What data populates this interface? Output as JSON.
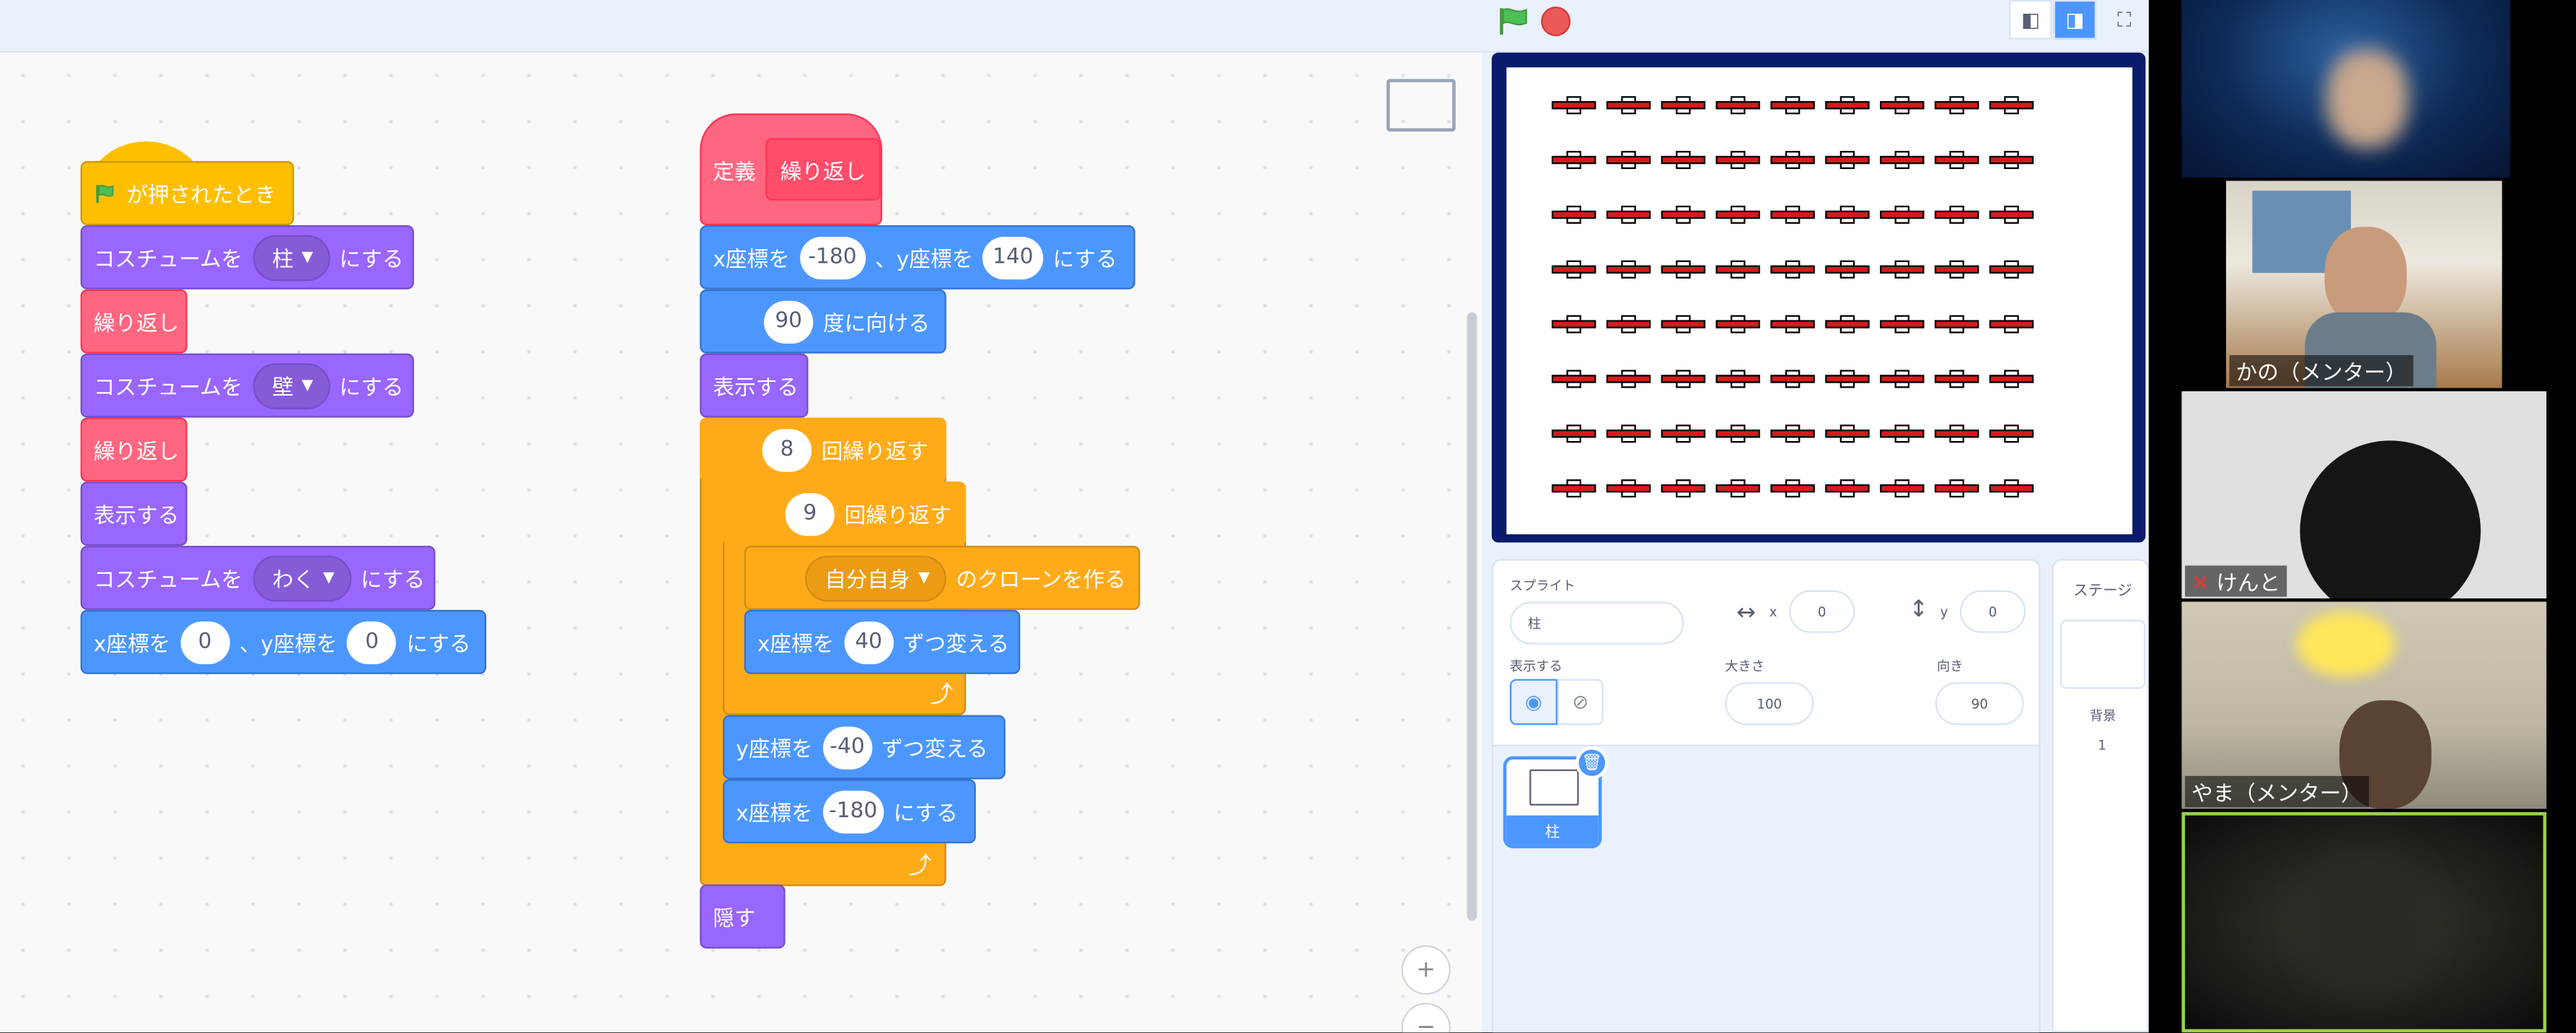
{
  "colors": {
    "motion": "#4c97ff",
    "looks": "#9966ff",
    "control": "#ffab19",
    "events": "#ffbf00",
    "custom": "#ff6680",
    "stage_border": "#0b1b6b",
    "wall_red": "#d41b1b"
  },
  "script1": {
    "hat_label": "が押されたとき",
    "b1": {
      "pre": "コスチュームを",
      "dd": "柱",
      "post": "にする"
    },
    "b2": "繰り返し",
    "b3": {
      "pre": "コスチュームを",
      "dd": "壁",
      "post": "にする"
    },
    "b4": "繰り返し",
    "b5": "表示する",
    "b6": {
      "pre": "コスチュームを",
      "dd": "わく",
      "post": "にする"
    },
    "b7": {
      "x_label": "x座標を",
      "x": "0",
      "y_label": "、y座標を",
      "y": "0",
      "post": "にする"
    }
  },
  "script2": {
    "define_label": "定義",
    "define_name": "繰り返し",
    "goto": {
      "x_label": "x座標を",
      "x": "-180",
      "y_label": "、y座標を",
      "y": "140",
      "post": "にする"
    },
    "point": {
      "val": "90",
      "label": "度に向ける"
    },
    "show": "表示する",
    "repeat_outer": {
      "val": "8",
      "label": "回繰り返す"
    },
    "repeat_inner": {
      "val": "9",
      "label": "回繰り返す"
    },
    "clone": {
      "dd": "自分自身",
      "label": "のクローンを作る"
    },
    "change_x": {
      "label": "x座標を",
      "val": "40",
      "post": "ずつ変える"
    },
    "change_y": {
      "label": "y座標を",
      "val": "-40",
      "post": "ずつ変える"
    },
    "set_x": {
      "label": "x座標を",
      "val": "-180",
      "post": "にする"
    },
    "hide": "隠す"
  },
  "stage": {
    "rows": 8,
    "cols": 9
  },
  "sprite_info": {
    "sprite_label": "スプライト",
    "sprite_name": "柱",
    "x_label": "x",
    "x_val": "0",
    "y_label": "y",
    "y_val": "0",
    "show_label": "表示する",
    "size_label": "大きさ",
    "size_val": "100",
    "direction_label": "向き",
    "direction_val": "90"
  },
  "sprite_list": [
    {
      "name": "柱",
      "selected": true
    }
  ],
  "stage_panel": {
    "title": "ステージ",
    "backdrop_label": "背景",
    "backdrop_count": "1"
  },
  "zoom": {
    "in": "+",
    "out": "−"
  },
  "participants": [
    {
      "name": ""
    },
    {
      "name": "かの（メンター）"
    },
    {
      "name": "けんと",
      "muted": true
    },
    {
      "name": "やま（メンター）"
    },
    {
      "name": ""
    }
  ]
}
